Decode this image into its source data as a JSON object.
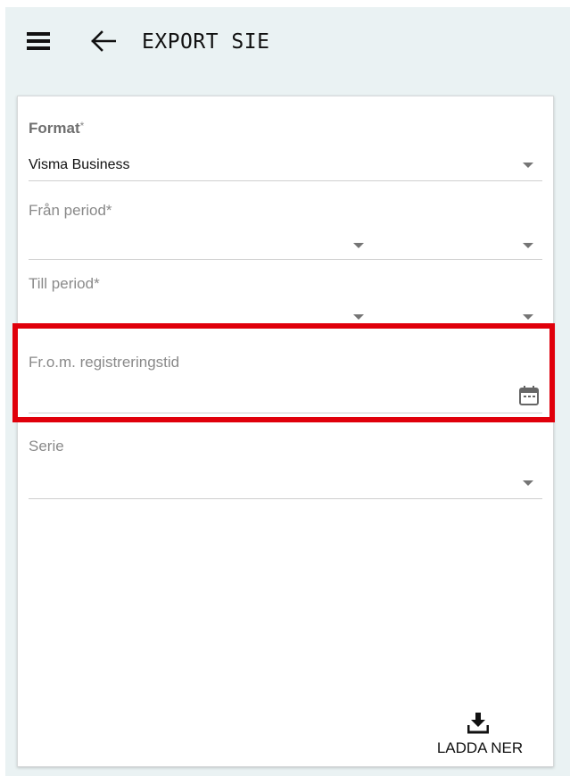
{
  "header": {
    "title": "EXPORT SIE",
    "menu_icon": "menu-icon",
    "back_icon": "arrow-left-icon"
  },
  "form": {
    "format": {
      "label": "Format",
      "required_mark": "*",
      "value": "Visma Business"
    },
    "from_period": {
      "label": "Från period*"
    },
    "till_period": {
      "label": "Till period*"
    },
    "registration_time": {
      "label": "Fr.o.m. registreringstid",
      "icon": "calendar-icon"
    },
    "serie": {
      "label": "Serie"
    }
  },
  "actions": {
    "download_label": "LADDA NER",
    "download_icon": "download-icon"
  },
  "colors": {
    "background": "#eaf2f3",
    "card": "#ffffff",
    "highlight": "#e0000b",
    "text": "#111111",
    "muted": "#8a8a8a"
  }
}
